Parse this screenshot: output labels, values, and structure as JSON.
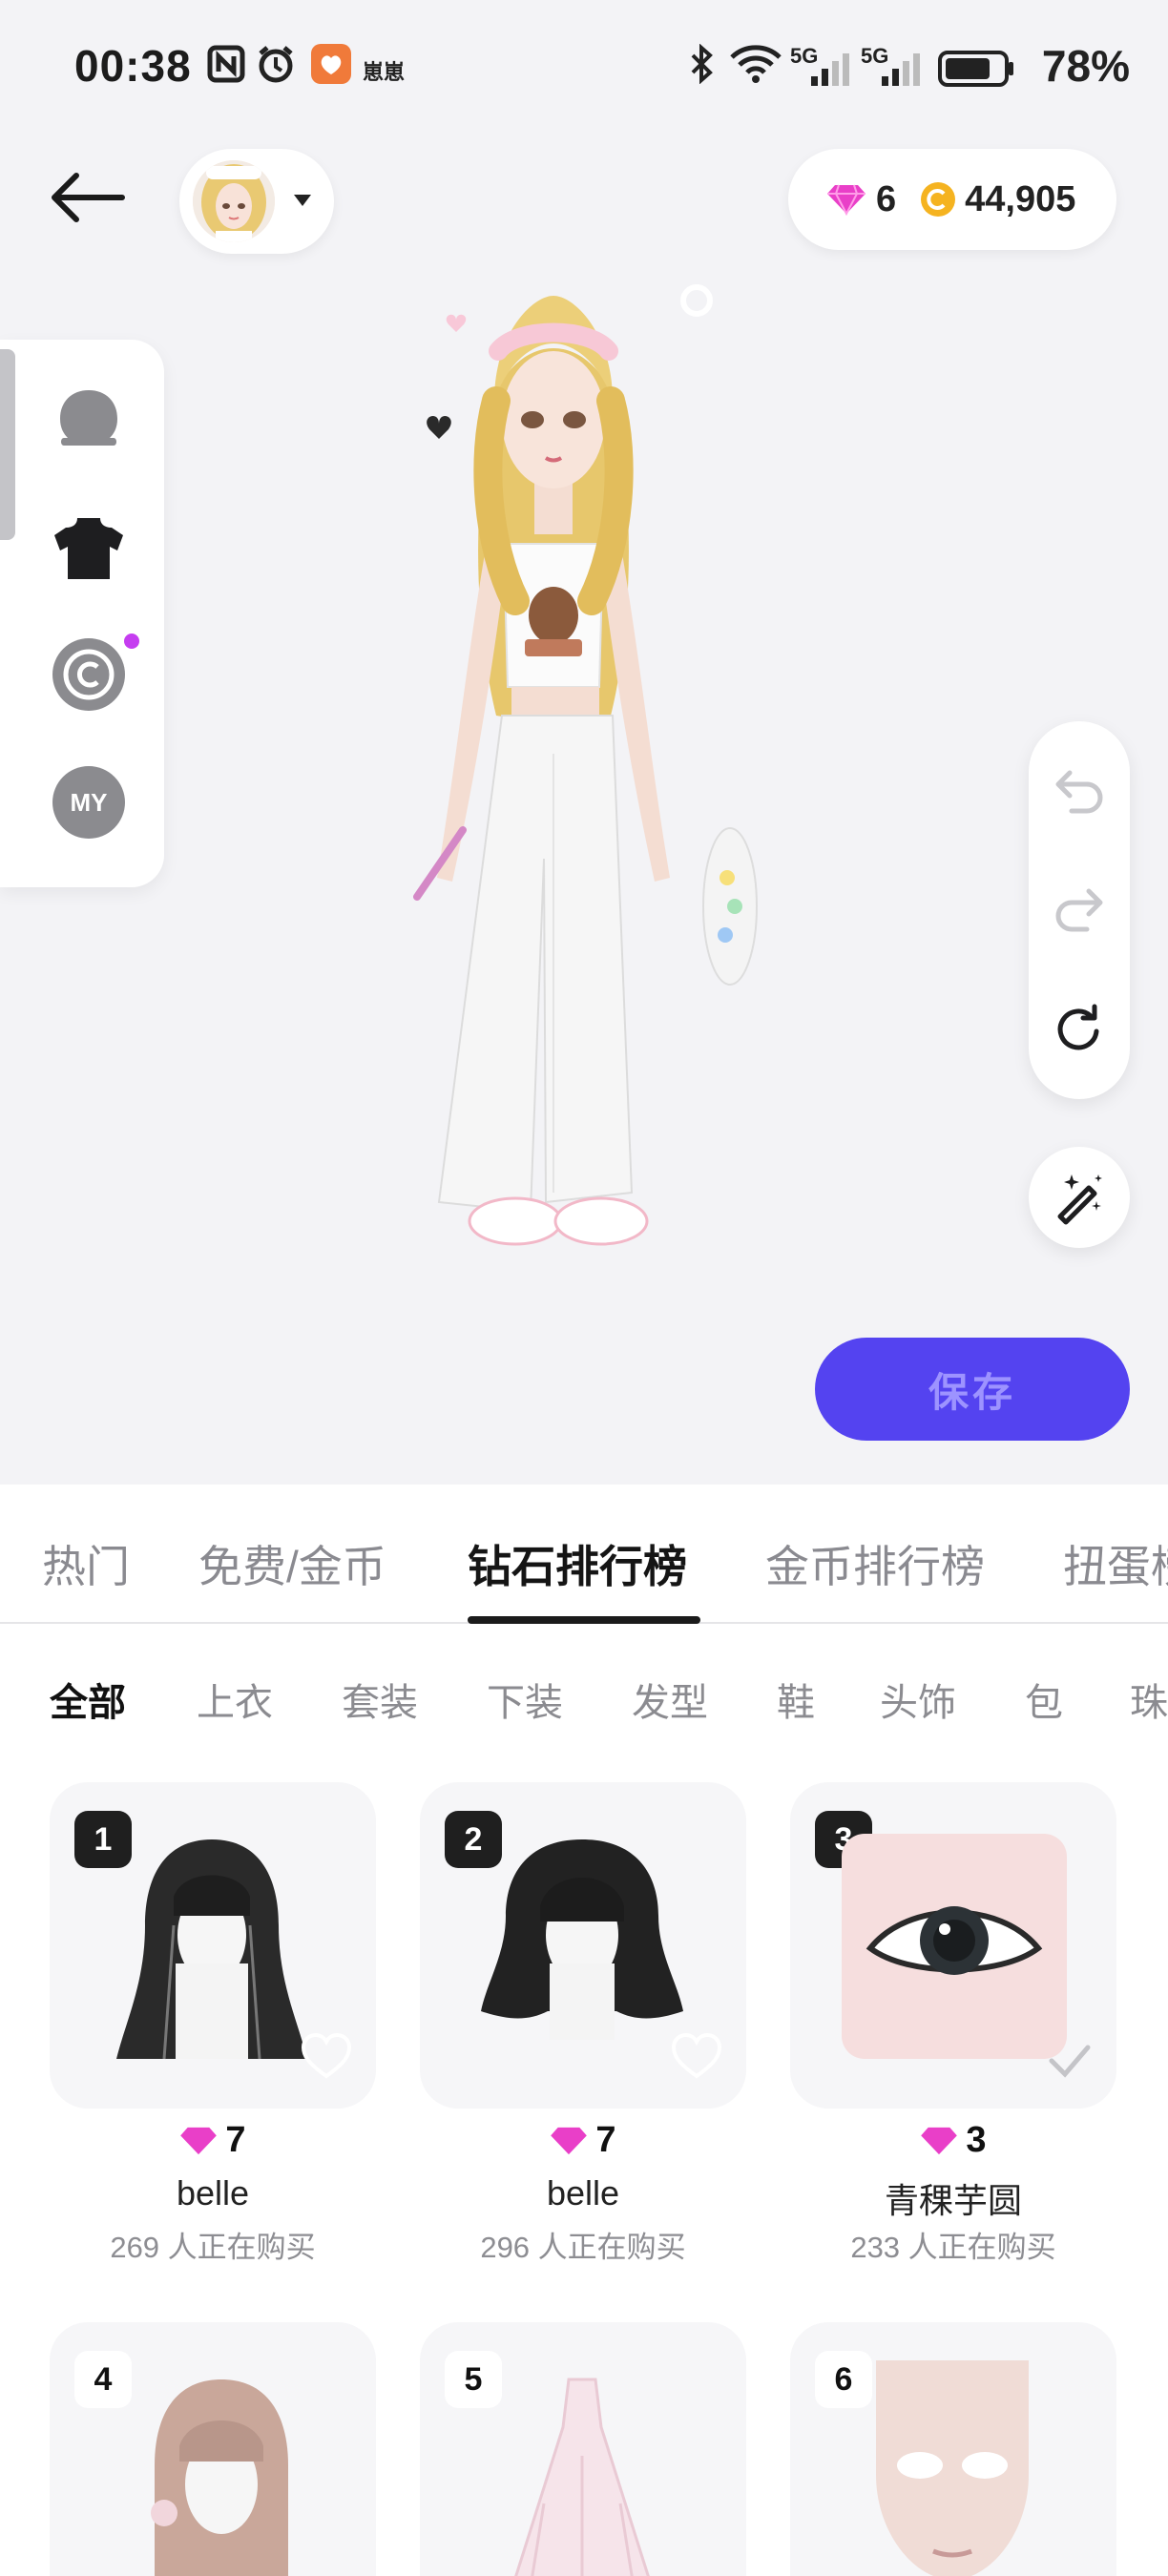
{
  "status_bar": {
    "time": "00:38",
    "app_label": "崽崽",
    "net1": "5G",
    "net2": "5G",
    "battery": "78%",
    "icons": [
      "nfc-icon",
      "alarm-icon",
      "app-notification-icon",
      "bluetooth-icon",
      "wifi-icon",
      "signal-icon",
      "battery-icon"
    ]
  },
  "header": {
    "diamonds": "6",
    "coins": "44,905"
  },
  "side_menu": {
    "items": [
      "head-icon",
      "tshirt-icon",
      "copyright-icon",
      "my-icon"
    ],
    "my_label": "MY",
    "dot_color": "#c53df0"
  },
  "actions": {
    "save_label": "保存"
  },
  "tabs": [
    "热门",
    "免费/金币",
    "钻石排行榜",
    "金币排行榜",
    "扭蛋榜"
  ],
  "active_tab": "钻石排行榜",
  "subtabs": [
    "全部",
    "上衣",
    "套装",
    "下装",
    "发型",
    "鞋",
    "头饰",
    "包",
    "珠"
  ],
  "active_subtab": "全部",
  "items": [
    {
      "rank": "1",
      "price": "7",
      "name": "belle",
      "buyers": "269 人正在购买"
    },
    {
      "rank": "2",
      "price": "7",
      "name": "belle",
      "buyers": "296 人正在购买"
    },
    {
      "rank": "3",
      "price": "3",
      "name": "青稞芋圆",
      "buyers": "233 人正在购买"
    },
    {
      "rank": "4"
    },
    {
      "rank": "5"
    },
    {
      "rank": "6"
    }
  ],
  "colors": {
    "accent": "#5443f0",
    "diamond": "#e93fc8",
    "coin": "#f5b320"
  }
}
